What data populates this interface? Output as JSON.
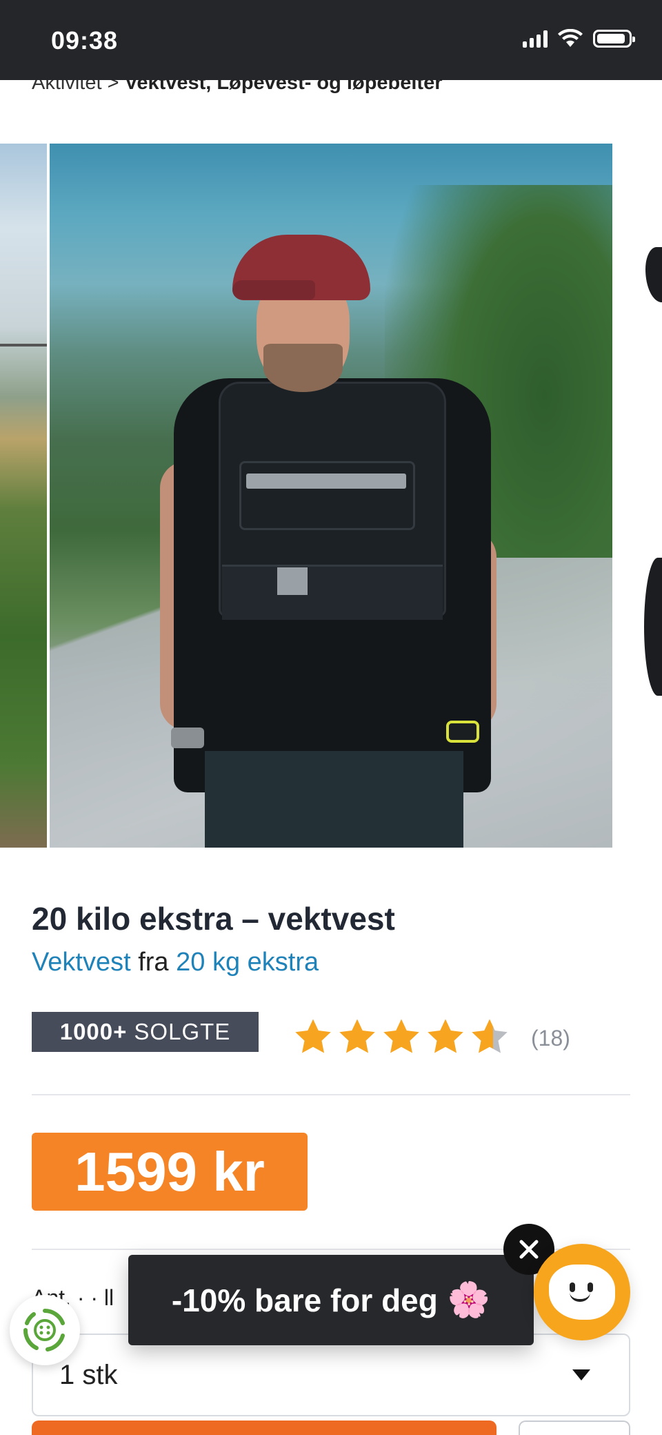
{
  "status_bar": {
    "time": "09:38",
    "icons": [
      "cellular-signal-icon",
      "wifi-icon",
      "battery-icon"
    ]
  },
  "breadcrumb": {
    "parent": "Aktivitet",
    "separator": ">",
    "current": "Vektvest, Løpevest- og løpebelter"
  },
  "product": {
    "title": "20 kilo ekstra – vektvest",
    "category_link": "Vektvest",
    "subtitle_connector": "fra",
    "brand_link": "20 kg ekstra",
    "sold_badge": {
      "count": "1000+",
      "label": "SOLGTE"
    },
    "rating": {
      "value": 4.6,
      "max": 5,
      "count_text": "(18)"
    },
    "price": "1599 kr"
  },
  "variant": {
    "label_partial": "Ant. · · ll",
    "quantity_value": "1 stk"
  },
  "promo": {
    "text": "-10% bare for deg",
    "emoji": "🌸"
  },
  "colors": {
    "price_bg": "#f58426",
    "link": "#1f82b8",
    "badge_bg": "#464c59",
    "star": "#f7a520",
    "cart_button": "#ee6a22",
    "chat_bubble": "#f7a51c"
  }
}
